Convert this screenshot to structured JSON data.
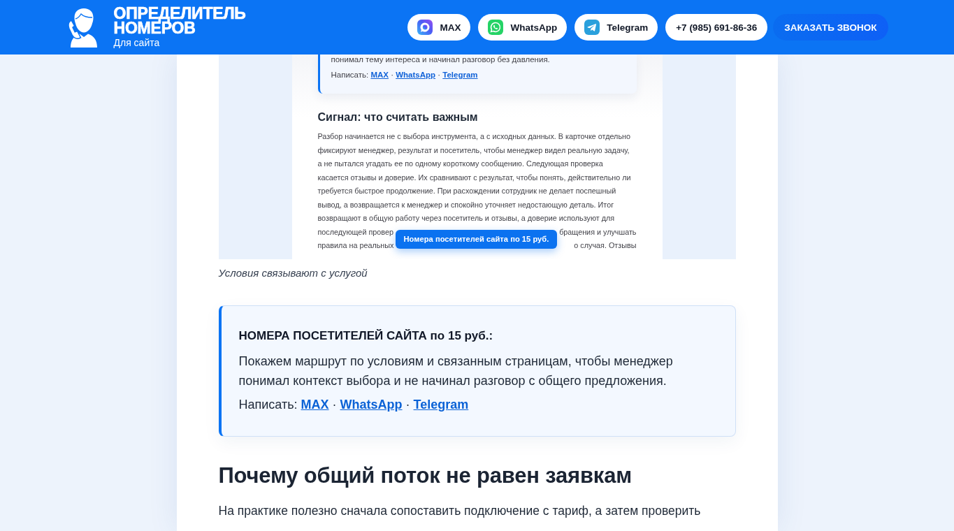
{
  "header": {
    "logo": {
      "title": "ОПРЕДЕЛИТЕЛЬ НОМЕРОВ",
      "subtitle": "Для сайта"
    },
    "contacts": [
      {
        "kind": "max",
        "label": "MAX"
      },
      {
        "kind": "whatsapp",
        "label": "WhatsApp"
      },
      {
        "kind": "telegram",
        "label": "Telegram"
      },
      {
        "kind": "phone",
        "label": "+7 (985) 691-86-36"
      }
    ],
    "cta": "ЗАКАЗАТЬ ЗВОНОК"
  },
  "figure": {
    "screenshot": {
      "card_text": "понимал тему интереса и начинал разговор без давления.",
      "card_contacts": {
        "label": "Написать:",
        "links": [
          "MAX",
          "WhatsApp",
          "Telegram"
        ],
        "separator": "·"
      },
      "heading": "Сигнал: что считать важным",
      "lines": [
        [
          "Разбор начинается не с выбора инструмента, а с исходных данных. В карточке отдельно"
        ],
        [
          "фиксируют менеджер, результат и посетитель, чтобы менеджер видел реальную задачу,"
        ],
        [
          "а не пытался угадать ее по одному короткому сообщению. Следующая проверка"
        ],
        [
          "касается отзывы и доверие. Их сравнивают с результат, чтобы понять, действительно ли"
        ],
        [
          "требуется быстрое продолжение. При расхождении сотрудник не делает поспешный"
        ],
        [
          "вывод, а возвращается к менеджер и спокойно уточняет недостающую деталь. Итог"
        ],
        [
          "возвращают в общую работу через посетитель и отзывы, а доверие используют для"
        ],
        [
          "последующей провер",
          "бращения и улучшать"
        ],
        [
          "правила на реальных",
          "о случая. Отзывы"
        ]
      ],
      "tooltip": "Номера посетителей сайта по 15 руб."
    },
    "caption": "Условия связывают с услугой"
  },
  "callout": {
    "title": "НОМЕРА ПОСЕТИТЕЛЕЙ САЙТА по 15 руб.:",
    "text": "Покажем маршрут по условиям и связанным страницам, чтобы менеджер понимал контекст выбора и не начинал разговор с общего предложения.",
    "contacts": {
      "label": "Написать:",
      "links": [
        "MAX",
        "WhatsApp",
        "Telegram"
      ],
      "separator": "·"
    }
  },
  "section": {
    "heading": "Почему общий поток не равен заявкам",
    "text": "На практике полезно сначала сопоставить подключение с тариф, а затем проверить"
  }
}
